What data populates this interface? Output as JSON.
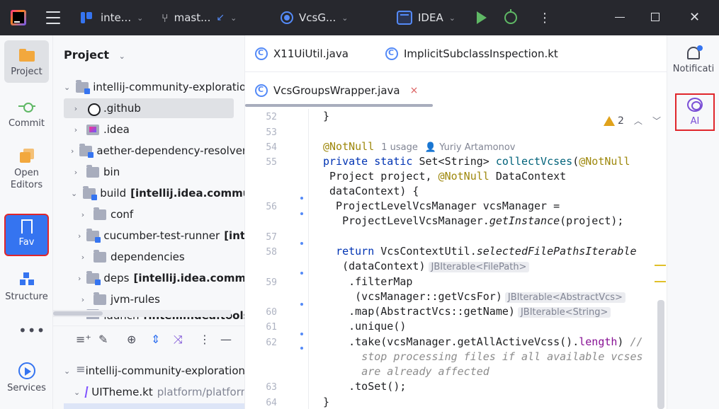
{
  "titlebar": {
    "project_name": "inte...",
    "branch": "mast...",
    "vcs_widget": "VcsG...",
    "run_config": "IDEA"
  },
  "left_strip": {
    "project": "Project",
    "commit": "Commit",
    "open_editors": "Open\nEditors",
    "fav": "Fav",
    "structure": "Structure",
    "more": "•••",
    "services": "Services"
  },
  "project_panel": {
    "title": "Project",
    "tree": [
      {
        "twisty": "⌄",
        "name": "intellij-community-exploration",
        "suffix": ""
      },
      {
        "twisty": "›",
        "name": ".github",
        "suffix": ""
      },
      {
        "twisty": "›",
        "name": ".idea",
        "suffix": ""
      },
      {
        "twisty": "›",
        "name": "aether-dependency-resolver",
        "suffix": ""
      },
      {
        "twisty": "›",
        "name": "bin",
        "suffix": ""
      },
      {
        "twisty": "⌄",
        "name": "build",
        "suffix": "[intellij.idea.community.build]"
      },
      {
        "twisty": "›",
        "name": "conf",
        "suffix": ""
      },
      {
        "twisty": "›",
        "name": "cucumber-test-runner",
        "suffix": "[intellij.tools.testsBootstrap]"
      },
      {
        "twisty": "›",
        "name": "dependencies",
        "suffix": ""
      },
      {
        "twisty": "›",
        "name": "deps",
        "suffix": "[intellij.idea.community.build.deps]"
      },
      {
        "twisty": "›",
        "name": "jvm-rules",
        "suffix": ""
      },
      {
        "twisty": "›",
        "name": "launch",
        "suffix": "[intellij.idea.tools.launcher]"
      }
    ],
    "bookmarks": [
      {
        "twisty": "⌄",
        "name": "intellij-community-exploration",
        "path": ""
      },
      {
        "twisty": "⌄",
        "name": "UITheme.kt",
        "path": "platform/platform-api"
      }
    ]
  },
  "editor": {
    "tabs": [
      {
        "label": "X11UiUtil.java"
      },
      {
        "label": "ImplicitSubclassInspection.kt"
      },
      {
        "label": "VcsGroupsWrapper.java"
      }
    ],
    "close_glyph": "×",
    "warning_count": "2",
    "line_numbers": [
      "52",
      "53",
      "54",
      "55",
      "56",
      "57",
      "58",
      "59",
      "60",
      "61",
      "62",
      "63",
      "64"
    ],
    "usage_hint": "1 usage",
    "author_hint": "Yuriy Artamonov",
    "type_hints": [
      "JBIterable<FilePath>",
      "JBIterable<AbstractVcs>",
      "JBIterable<String>"
    ]
  },
  "right_strip": {
    "notifications": "Notificati",
    "ai": "AI"
  },
  "colors": {
    "titlebar_bg": "#27282e",
    "accent": "#3574f0",
    "highlight_border": "#e0262b",
    "keyword": "#0033b3",
    "annotation": "#9e880d"
  }
}
